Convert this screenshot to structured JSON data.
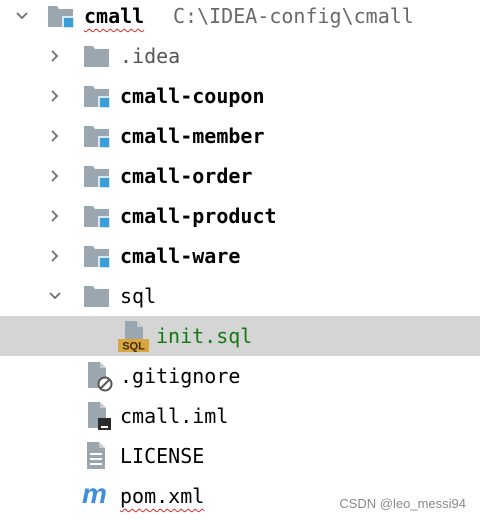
{
  "project": {
    "name": "cmall",
    "path": "C:\\IDEA-config\\cmall"
  },
  "tree": [
    {
      "label": ".idea",
      "kind": "folder",
      "expanded": false
    },
    {
      "label": "cmall-coupon",
      "kind": "module",
      "expanded": false
    },
    {
      "label": "cmall-member",
      "kind": "module",
      "expanded": false
    },
    {
      "label": "cmall-order",
      "kind": "module",
      "expanded": false
    },
    {
      "label": "cmall-product",
      "kind": "module",
      "expanded": false
    },
    {
      "label": "cmall-ware",
      "kind": "module",
      "expanded": false
    },
    {
      "label": "sql",
      "kind": "folder",
      "expanded": true
    },
    {
      "label": "init.sql",
      "kind": "sql-file",
      "selected": true
    },
    {
      "label": ".gitignore",
      "kind": "ignore-file"
    },
    {
      "label": "cmall.iml",
      "kind": "iml-file"
    },
    {
      "label": "LICENSE",
      "kind": "text-file"
    },
    {
      "label": "pom.xml",
      "kind": "maven-file"
    }
  ],
  "icons": {
    "sql_badge": "SQL",
    "maven_glyph": "m"
  },
  "colors": {
    "selection": "#d5d5d5",
    "module_badge": "#3a9fd8",
    "sql_badge": "#d9a53f",
    "maven": "#3b8fdc",
    "changed_file": "#137a13"
  },
  "watermark": "CSDN @leo_messi94"
}
